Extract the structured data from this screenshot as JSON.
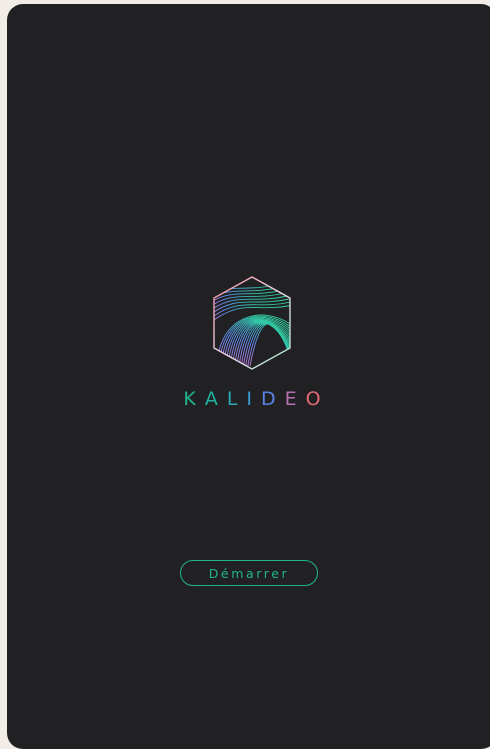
{
  "app": {
    "brand_name": "KALIDEO",
    "brand_letters": [
      {
        "char": "K",
        "color": "#20b48e"
      },
      {
        "char": "A",
        "color": "#23b1a0"
      },
      {
        "char": "L",
        "color": "#2aaab8"
      },
      {
        "char": "I",
        "color": "#3a98d6"
      },
      {
        "char": "D",
        "color": "#5b82e6"
      },
      {
        "char": "E",
        "color": "#b86fb0"
      },
      {
        "char": "O",
        "color": "#e06a78"
      }
    ],
    "logo_icon": "hexagon-wave-logo-icon"
  },
  "actions": {
    "start_label": "Démarrer"
  },
  "colors": {
    "background": "#212123",
    "accent": "#1fb58a",
    "page": "#f1ede6"
  }
}
